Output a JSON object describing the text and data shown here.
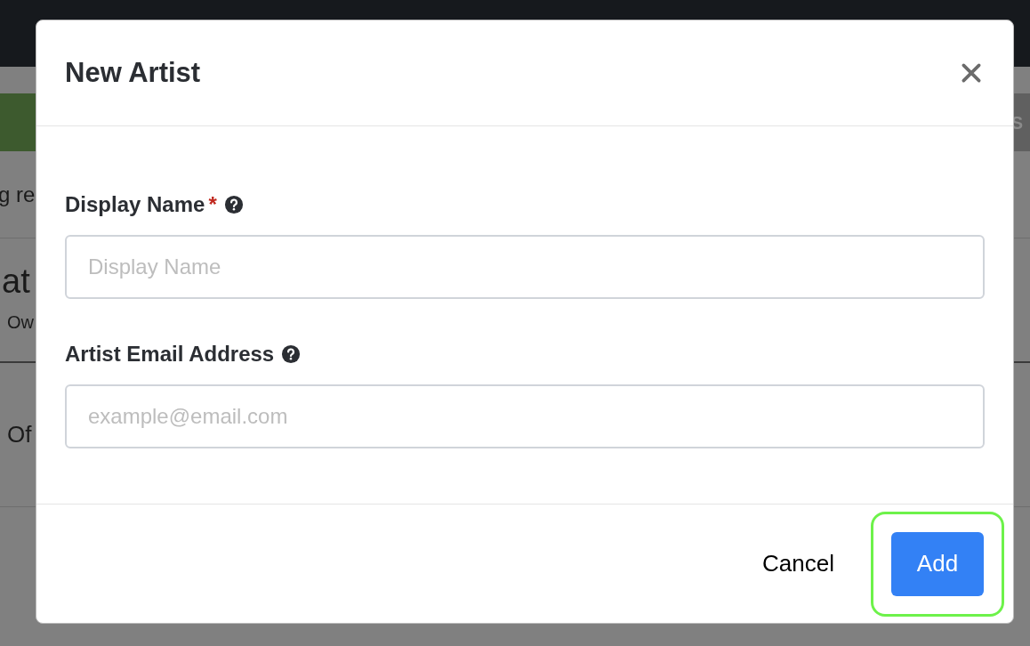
{
  "background": {
    "banner_right": "S",
    "line_1": "g re",
    "heading": "at",
    "subheading": "Ow",
    "line_2": "Of"
  },
  "modal": {
    "title": "New Artist",
    "fields": [
      {
        "label": "Display Name",
        "required_mark": "*",
        "placeholder": "Display Name"
      },
      {
        "label": "Artist Email Address",
        "placeholder": "example@email.com"
      }
    ],
    "buttons": [
      {
        "label": "Cancel",
        "kind": "secondary",
        "highlighted": false
      },
      {
        "label": "Add",
        "kind": "primary",
        "highlighted": true
      }
    ]
  }
}
